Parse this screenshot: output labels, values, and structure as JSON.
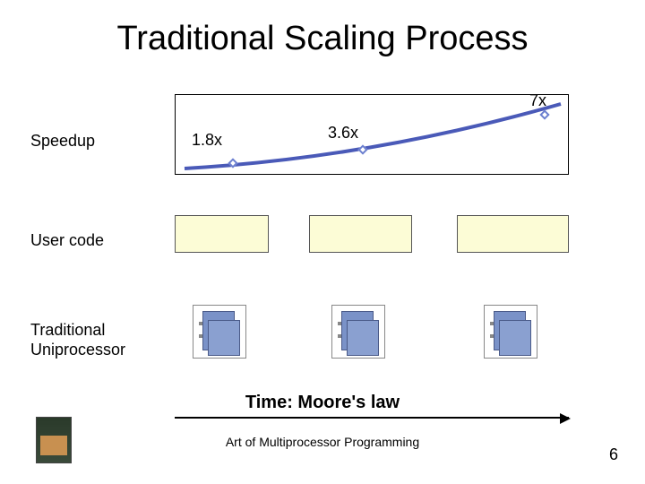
{
  "title": "Traditional Scaling Process",
  "rows": {
    "speedup": "Speedup",
    "usercode": "User code",
    "traditional": "Traditional\nUniprocessor"
  },
  "chart_data": {
    "type": "line",
    "title": "Speedup",
    "xlabel": "Time: Moore's law",
    "ylabel": "",
    "x": [
      1,
      2,
      3
    ],
    "values": [
      1.8,
      3.6,
      7
    ],
    "value_labels": [
      "1.8x",
      "3.6x",
      "7x"
    ],
    "ylim": [
      0,
      8
    ]
  },
  "time_axis": "Time: Moore's law",
  "footer": "Art of Multiprocessor Programming",
  "page": "6"
}
